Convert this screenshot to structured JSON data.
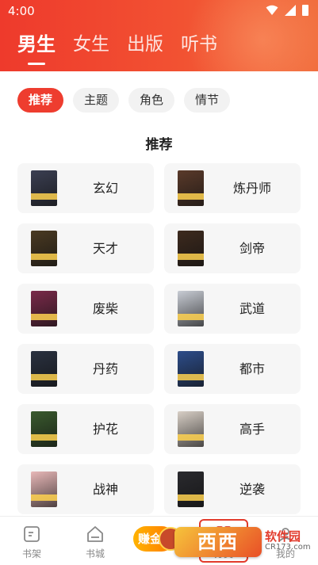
{
  "status_bar": {
    "time": "4:00"
  },
  "top_tabs": [
    {
      "label": "男生",
      "active": true
    },
    {
      "label": "女生",
      "active": false
    },
    {
      "label": "出版",
      "active": false
    },
    {
      "label": "听书",
      "active": false
    }
  ],
  "chips": [
    {
      "label": "推荐",
      "active": true
    },
    {
      "label": "主题",
      "active": false
    },
    {
      "label": "角色",
      "active": false
    },
    {
      "label": "情节",
      "active": false
    }
  ],
  "section_title": "推荐",
  "categories": [
    {
      "label": "玄幻",
      "cover_color": "#3b3f52"
    },
    {
      "label": "炼丹师",
      "cover_color": "#5a3a2a"
    },
    {
      "label": "天才",
      "cover_color": "#4a3a22"
    },
    {
      "label": "剑帝",
      "cover_color": "#3d2a1e"
    },
    {
      "label": "废柴",
      "cover_color": "#7a2a4a"
    },
    {
      "label": "武道",
      "cover_color": "#c8ccd4"
    },
    {
      "label": "丹药",
      "cover_color": "#2a3140"
    },
    {
      "label": "都市",
      "cover_color": "#2d4d8a"
    },
    {
      "label": "护花",
      "cover_color": "#3a5a2e"
    },
    {
      "label": "高手",
      "cover_color": "#d8cfc6"
    },
    {
      "label": "战神",
      "cover_color": "#e8b8b8"
    },
    {
      "label": "逆袭",
      "cover_color": "#2a2a2e"
    }
  ],
  "bottom_nav": {
    "bookshelf": "书架",
    "bookstore": "书城",
    "earn": "赚金",
    "category": "分类",
    "mine": "我的"
  },
  "watermark": {
    "logo": "西西",
    "site_name": "软件园",
    "site_url": "CR173.com"
  },
  "colors": {
    "brand_red": "#ee3d2f",
    "card_bg": "#f6f6f6"
  }
}
